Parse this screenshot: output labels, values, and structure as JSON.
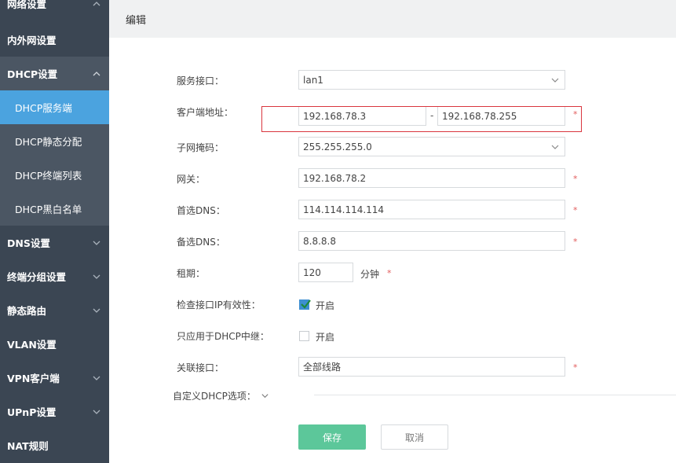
{
  "sidebar": {
    "items": [
      {
        "label": "网络设置",
        "chevron": "up"
      },
      {
        "label": "内外网设置"
      },
      {
        "label": "DHCP设置",
        "chevron": "up"
      },
      {
        "label": "DHCP服务端",
        "active": true
      },
      {
        "label": "DHCP静态分配"
      },
      {
        "label": "DHCP终端列表"
      },
      {
        "label": "DHCP黑白名单"
      },
      {
        "label": "DNS设置",
        "chevron": "down"
      },
      {
        "label": "终端分组设置",
        "chevron": "down"
      },
      {
        "label": "静态路由",
        "chevron": "down"
      },
      {
        "label": "VLAN设置"
      },
      {
        "label": "VPN客户端",
        "chevron": "down"
      },
      {
        "label": "UPnP设置",
        "chevron": "down"
      },
      {
        "label": "NAT规则"
      }
    ]
  },
  "header": {
    "title": "编辑"
  },
  "form": {
    "service_interface": {
      "label": "服务接口：",
      "value": "lan1"
    },
    "client_address": {
      "label": "客户端地址：",
      "start": "192.168.78.3",
      "separator": "-",
      "end": "192.168.78.255"
    },
    "subnet_mask": {
      "label": "子网掩码：",
      "value": "255.255.255.0"
    },
    "gateway": {
      "label": "网关：",
      "value": "192.168.78.2"
    },
    "primary_dns": {
      "label": "首选DNS：",
      "value": "114.114.114.114"
    },
    "secondary_dns": {
      "label": "备选DNS：",
      "value": "8.8.8.8"
    },
    "lease": {
      "label": "租期：",
      "value": "120",
      "unit": "分钟"
    },
    "check_ip": {
      "label": "检查接口IP有效性：",
      "option": "开启",
      "checked": true
    },
    "relay_only": {
      "label": "只应用于DHCP中继：",
      "option": "开启",
      "checked": false
    },
    "linked_interface": {
      "label": "关联接口：",
      "value": "全部线路"
    },
    "custom_options": {
      "label": "自定义DHCP选项："
    },
    "required_mark": "*"
  },
  "buttons": {
    "save": "保存",
    "cancel": "取消"
  },
  "colors": {
    "sidebar_bg": "#3b4653",
    "active": "#4ba3df",
    "save": "#5cc79a",
    "highlight": "#d9363e",
    "required": "#e25b5b"
  }
}
